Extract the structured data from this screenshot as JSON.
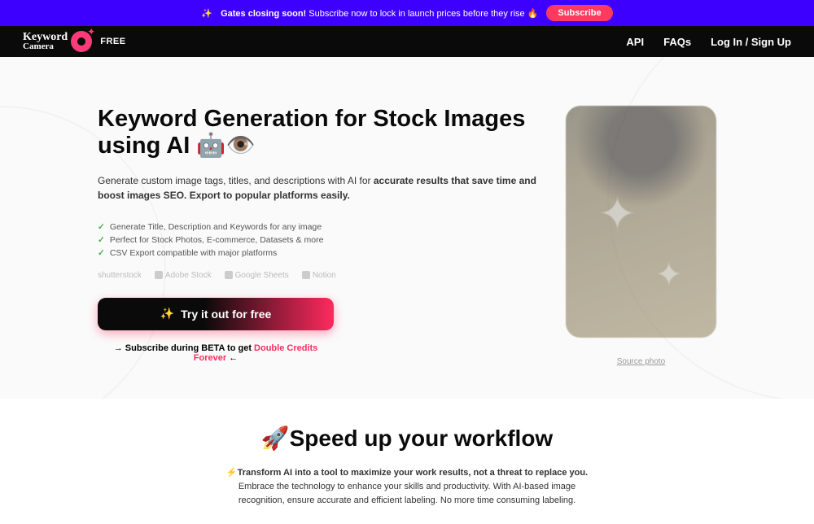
{
  "announcement": {
    "emoji_lead": "✨",
    "bold": "Gates closing soon!",
    "text": "Subscribe now to lock in launch prices before they rise 🔥",
    "cta": "Subscribe"
  },
  "header": {
    "logo_line1": "Keyword",
    "logo_line2": "Camera",
    "badge": "FREE",
    "nav": {
      "api": "API",
      "faqs": "FAQs",
      "login": "Log In / Sign Up"
    }
  },
  "hero": {
    "title": "Keyword Generation for Stock Images using AI 🤖👁️",
    "sub_pre": "Generate custom image tags, titles, and descriptions with AI for ",
    "sub_bold": "accurate results that save time and boost images SEO. Export to popular platforms easily.",
    "features": [
      "Generate Title, Description and Keywords for any image",
      "Perfect for Stock Photos, E-commerce, Datasets & more",
      "CSV Export compatible with major platforms"
    ],
    "platforms": [
      "shutterstock",
      "Adobe Stock",
      "Google Sheets",
      "Notion"
    ],
    "cta": "Try it out for free",
    "cta_icon": "✨",
    "beta_pre": "→ Subscribe during BETA to get ",
    "beta_highlight": "Double Credits Forever",
    "beta_post": " ←",
    "source_caption": "Source photo"
  },
  "section2": {
    "title": "🚀Speed up your workflow",
    "emoji": "⚡",
    "bold": "Transform AI into a tool to maximize your work results, not a threat to replace you.",
    "text": " Embrace the technology to enhance your skills and productivity. With AI-based image recognition, ensure accurate and efficient labeling. No more time consuming labeling."
  }
}
